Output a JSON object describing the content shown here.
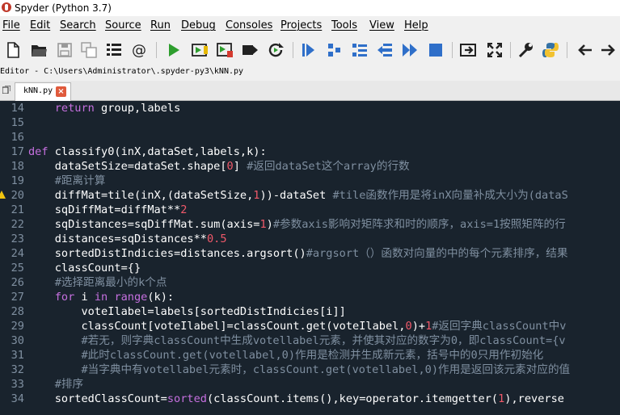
{
  "window": {
    "title": "Spyder (Python 3.7)"
  },
  "menu": [
    "File",
    "Edit",
    "Search",
    "Source",
    "Run",
    "Debug",
    "Consoles",
    "Projects",
    "Tools",
    "View",
    "Help"
  ],
  "toolbar_icons": [
    "new-file-icon",
    "open-folder-icon",
    "save-icon",
    "save-all-icon",
    "list-icon",
    "at-icon",
    "run-icon",
    "run-cell-icon",
    "run-cell-advance-icon",
    "run-selection-icon",
    "rerun-icon",
    "debug-icon",
    "step-icon",
    "step-into-icon",
    "step-return-icon",
    "continue-icon",
    "stop-icon",
    "maximize-pane-icon",
    "fullscreen-icon",
    "preferences-icon",
    "python-path-icon",
    "back-icon",
    "forward-icon"
  ],
  "editor": {
    "path": "Editor - C:\\Users\\Administrator\\.spyder-py3\\kNN.py",
    "tab": "kNN.py"
  },
  "code_lines": [
    {
      "n": "14",
      "segs": [
        {
          "t": "    "
        },
        {
          "t": "return",
          "c": "k"
        },
        {
          "t": " group,labels"
        }
      ]
    },
    {
      "n": "15",
      "segs": []
    },
    {
      "n": "16",
      "segs": []
    },
    {
      "n": "17",
      "segs": [
        {
          "t": "def",
          "c": "k"
        },
        {
          "t": " classify0(inX,dataSet,labels,k):"
        }
      ]
    },
    {
      "n": "18",
      "segs": [
        {
          "t": "    dataSetSize=dataSet.shape["
        },
        {
          "t": "0",
          "c": "n"
        },
        {
          "t": "] "
        },
        {
          "t": "#返回dataSet这个array的行数",
          "c": "c"
        }
      ]
    },
    {
      "n": "19",
      "segs": [
        {
          "t": "    "
        },
        {
          "t": "#距离计算",
          "c": "c"
        }
      ]
    },
    {
      "n": "20",
      "warn": true,
      "segs": [
        {
          "t": "    diffMat=tile(inX,(dataSetSize,"
        },
        {
          "t": "1",
          "c": "n"
        },
        {
          "t": "))-dataSet "
        },
        {
          "t": "#tile函数作用是将inX向量补成大小为(dataS",
          "c": "c"
        }
      ]
    },
    {
      "n": "21",
      "segs": [
        {
          "t": "    sqDiffMat=diffMat**"
        },
        {
          "t": "2",
          "c": "n"
        }
      ]
    },
    {
      "n": "22",
      "segs": [
        {
          "t": "    sqDistances=sqDiffMat.sum(axis="
        },
        {
          "t": "1",
          "c": "n"
        },
        {
          "t": ")"
        },
        {
          "t": "#参数axis影响对矩阵求和时的顺序，axis=1按照矩阵的行",
          "c": "c"
        }
      ]
    },
    {
      "n": "23",
      "segs": [
        {
          "t": "    distances=sqDistances**"
        },
        {
          "t": "0.5",
          "c": "n"
        }
      ]
    },
    {
      "n": "24",
      "segs": [
        {
          "t": "    sortedDistIndicies=distances.argsort()"
        },
        {
          "t": "#argsort（）函数对向量的中的每个元素排序，结果",
          "c": "c"
        }
      ]
    },
    {
      "n": "25",
      "segs": [
        {
          "t": "    classCount={}"
        }
      ]
    },
    {
      "n": "26",
      "segs": [
        {
          "t": "    "
        },
        {
          "t": "#选择距离最小的k个点",
          "c": "c"
        }
      ]
    },
    {
      "n": "27",
      "segs": [
        {
          "t": "    "
        },
        {
          "t": "for",
          "c": "k"
        },
        {
          "t": " i "
        },
        {
          "t": "in",
          "c": "k"
        },
        {
          "t": " "
        },
        {
          "t": "range",
          "c": "b"
        },
        {
          "t": "(k):"
        }
      ]
    },
    {
      "n": "28",
      "segs": [
        {
          "t": "        voteIlabel=labels[sortedDistIndicies[i]]"
        }
      ]
    },
    {
      "n": "29",
      "segs": [
        {
          "t": "        classCount[voteIlabel]=classCount.get(voteIlabel,"
        },
        {
          "t": "0",
          "c": "n"
        },
        {
          "t": ")+"
        },
        {
          "t": "1",
          "c": "n"
        },
        {
          "t": "#返回字典classCount中v",
          "c": "c"
        }
      ]
    },
    {
      "n": "30",
      "segs": [
        {
          "t": "        "
        },
        {
          "t": "#若无，则字典classCount中生成votellabel元素，并使其对应的数字为0，即classCount={v",
          "c": "c"
        }
      ]
    },
    {
      "n": "31",
      "segs": [
        {
          "t": "        "
        },
        {
          "t": "#此时classCount.get(votellabel,0)作用是检测并生成新元素，括号中的0只用作初始化",
          "c": "c"
        }
      ]
    },
    {
      "n": "32",
      "segs": [
        {
          "t": "        "
        },
        {
          "t": "#当字典中有votellabel元素时，classCount.get(votellabel,0)作用是返回该元素对应的值",
          "c": "c"
        }
      ]
    },
    {
      "n": "33",
      "segs": [
        {
          "t": "    "
        },
        {
          "t": "#排序",
          "c": "c"
        }
      ]
    },
    {
      "n": "34",
      "segs": [
        {
          "t": "    sortedClassCount="
        },
        {
          "t": "sorted",
          "c": "b"
        },
        {
          "t": "(classCount.items(),key=operator.itemgetter("
        },
        {
          "t": "1",
          "c": "n"
        },
        {
          "t": "),reverse"
        }
      ]
    }
  ]
}
